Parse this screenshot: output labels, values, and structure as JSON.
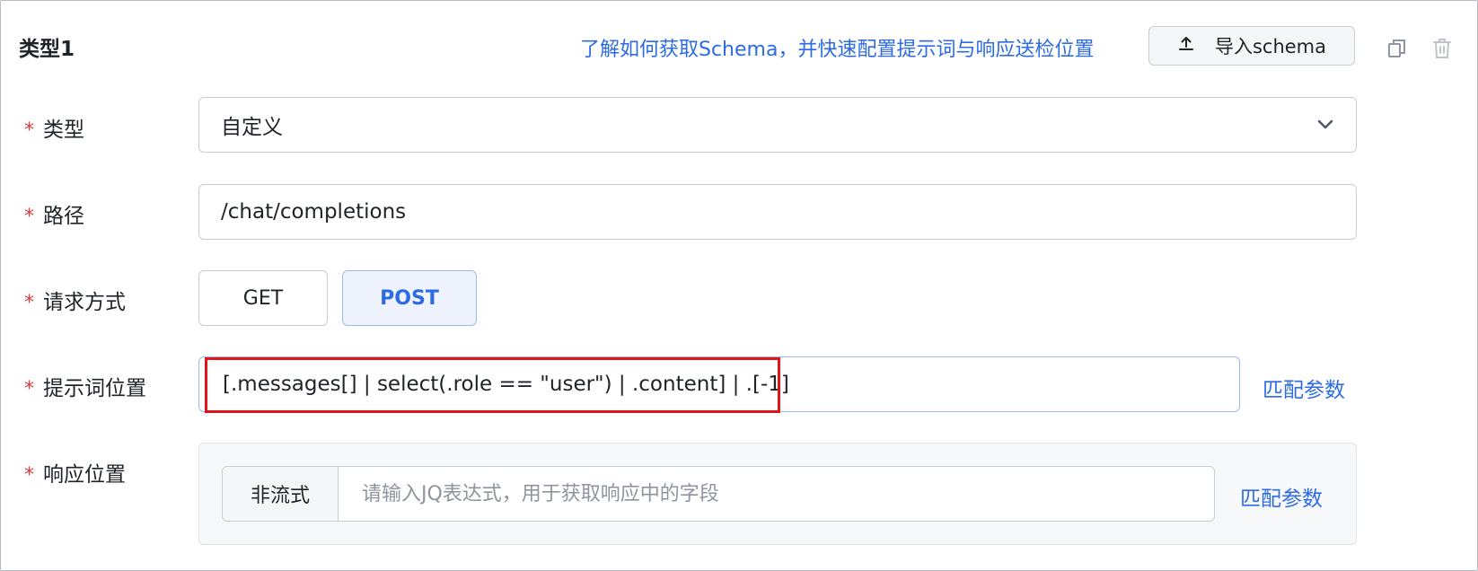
{
  "header": {
    "title": "类型1",
    "help_link": "了解如何获取Schema，并快速配置提示词与响应送检位置",
    "import_button": "导入schema"
  },
  "form": {
    "type_row": {
      "label": "类型",
      "value": "自定义"
    },
    "path_row": {
      "label": "路径",
      "value": "/chat/completions"
    },
    "method_row": {
      "label": "请求方式",
      "options": [
        "GET",
        "POST"
      ],
      "selected": "POST"
    },
    "prompt_row": {
      "label": "提示词位置",
      "value": "[.messages[] | select(.role == \"user\") | .content] | .[-1]",
      "match_link": "匹配参数"
    },
    "response_row": {
      "label": "响应位置",
      "mode": "非流式",
      "placeholder": "请输入JQ表达式，用于获取响应中的字段",
      "match_link": "匹配参数"
    }
  },
  "required_mark": "*",
  "colors": {
    "accent": "#2d6be4",
    "required": "#e03a3a",
    "highlight": "#e0151b"
  },
  "icons": [
    "upload-icon",
    "copy-icon",
    "trash-icon",
    "chevron-down-icon"
  ]
}
